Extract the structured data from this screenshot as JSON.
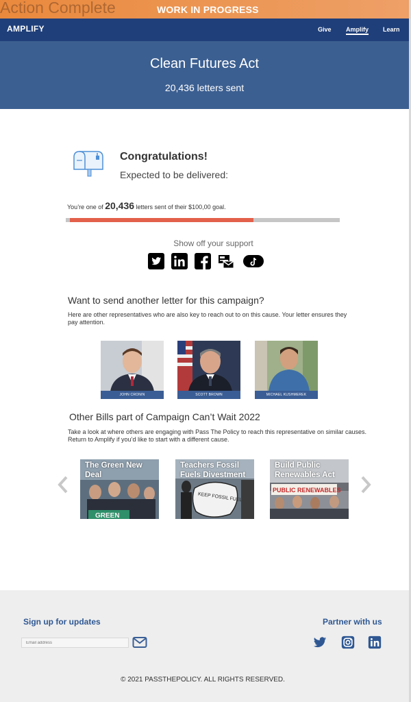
{
  "banner": {
    "left_text": "Action Complete",
    "center_text": "WORK IN PROGRESS"
  },
  "nav": {
    "brand": "AMPLIFY",
    "links": [
      "Give",
      "Amplify",
      "Learn"
    ],
    "active": "Amplify"
  },
  "hero": {
    "title": "Clean Futures Act",
    "subtitle": "20,436 letters sent"
  },
  "congrats": {
    "title": "Congratulations!",
    "subtitle": "Expected to be delivered:",
    "stat_prefix": "You’re one of ",
    "stat_count": "20,436",
    "stat_suffix": " letters sent of their $100,00 goal.",
    "progress_fraction": 0.68
  },
  "share": {
    "label": "Show off your support",
    "icons": [
      "twitter-icon",
      "linkedin-icon",
      "facebook-icon",
      "newsletter-icon",
      "tiktok-icon"
    ]
  },
  "reps_section": {
    "heading": "Want to send another letter for this campaign?",
    "description": "Here are other representatives who are also key to reach out to on this cause. Your letter ensures they pay attention.",
    "reps": [
      {
        "name": "JOHN CRONIN"
      },
      {
        "name": "SCOTT BROWN"
      },
      {
        "name": "MICHAEL KUSHMEREK"
      }
    ]
  },
  "bills_section": {
    "heading": "Other Bills part of Campaign Can’t Wait 2022",
    "description": "Take a look at where others are engaging with Pass The Policy to reach this representative on similar causes. Return to Amplify if you’d like to start with a different cause.",
    "bills": [
      {
        "title": "The Green New Deal",
        "sign": "GREEN"
      },
      {
        "title": "Teachers Fossil Fuels Divestment",
        "sign": "KEEP FOSSIL FUELS IN THE GROUND"
      },
      {
        "title": "Build Public Renewables Act",
        "sign": "PUBLIC RENEWABLES"
      }
    ]
  },
  "footer": {
    "signup_label": "Sign up for updates",
    "email_placeholder": "Email address",
    "partner_label": "Partner with us",
    "copyright": "© 2021 PASSTHEPOLICY. ALL RIGHTS RESERVED."
  },
  "colors": {
    "nav": "#1f3f7a",
    "hero": "#3c5f91",
    "progress": "#e3604a",
    "accent": "#2f5893"
  }
}
